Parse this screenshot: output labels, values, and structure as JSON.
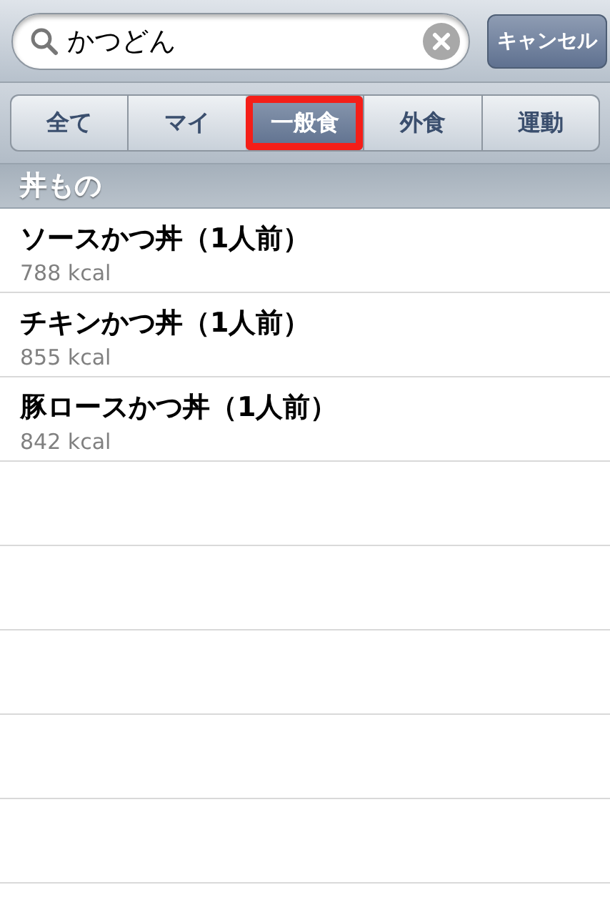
{
  "search": {
    "value": "かつどん"
  },
  "cancel_button": "キャンセル",
  "scope_tabs": [
    {
      "label": "全て",
      "selected": false,
      "highlighted": false
    },
    {
      "label": "マイ",
      "selected": false,
      "highlighted": false
    },
    {
      "label": "一般食",
      "selected": true,
      "highlighted": true
    },
    {
      "label": "外食",
      "selected": false,
      "highlighted": false
    },
    {
      "label": "運動",
      "selected": false,
      "highlighted": false
    }
  ],
  "section": {
    "title": "丼もの",
    "rows": [
      {
        "name": "ソースかつ丼（1人前）",
        "calories": "788 kcal"
      },
      {
        "name": "チキンかつ丼（1人前）",
        "calories": "855 kcal"
      },
      {
        "name": "豚ロースかつ丼（1人前）",
        "calories": "842 kcal"
      }
    ]
  }
}
